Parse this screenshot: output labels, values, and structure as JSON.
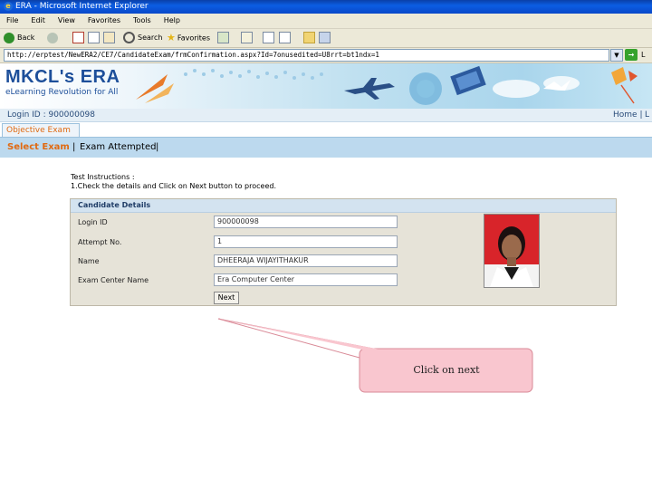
{
  "window": {
    "title": "ERA - Microsoft Internet Explorer"
  },
  "menu": [
    "File",
    "Edit",
    "View",
    "Favorites",
    "Tools",
    "Help"
  ],
  "toolbar": {
    "back_label": "Back",
    "search_label": "Search",
    "favorites_label": "Favorites"
  },
  "address": {
    "url": "http://erptest/NewERA2/CE7/CandidateExam/frmConfirmation.aspx?Id=7onusedited=U8rrt=bt1ndx=1",
    "links_label": "L"
  },
  "banner": {
    "logo_prefix": "MKCL's",
    "logo_era": "ERA",
    "tagline": "eLearning Revolution for All"
  },
  "login_strip": {
    "login_text": "Login ID : 900000098",
    "home": "Home",
    "separator": "|",
    "logout": "L"
  },
  "tabs": {
    "objective_exam": "Objective Exam"
  },
  "nav": {
    "select_exam": "Select Exam",
    "sep": "|",
    "exam_attempted": "Exam Attempted"
  },
  "instructions": {
    "title": "Test Instructions :",
    "line1": "1.Check the details and Click on Next button to proceed."
  },
  "candidate": {
    "header": "Candidate Details",
    "fields": [
      {
        "label": "Login ID",
        "value": "900000098"
      },
      {
        "label": "Attempt No.",
        "value": "1"
      },
      {
        "label": "Name",
        "value": "DHEERAJA WIJAYITHAKUR"
      },
      {
        "label": "Exam Center Name",
        "value": "Era Computer Center"
      }
    ],
    "next_button": "Next"
  },
  "callout": {
    "text": "Click on next"
  },
  "colors": {
    "accent_orange": "#e06a12",
    "nav_blue": "#bcd9ee",
    "callout_fill": "#f9c6cf",
    "callout_border": "#d98a97"
  }
}
